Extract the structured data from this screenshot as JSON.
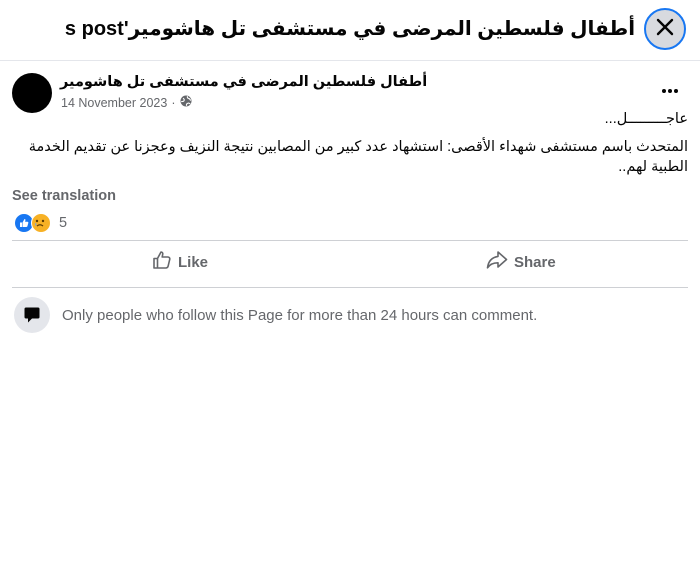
{
  "header": {
    "title": "أطفال فلسطين المرضى في مستشفى تل هاشومير's post",
    "close_icon": "close-icon"
  },
  "post": {
    "author": "أطفال فلسطين المرضى في مستشفى تل هاشومير",
    "date": "14 November 2023",
    "separator": "·",
    "audience_icon": "globe-icon",
    "more_icon": "more-icon",
    "text_line1": "عاجـــــــــل...",
    "text_line2": "المتحدث باسم مستشفى شهداء الأقصى: استشهاد عدد كبير من المصابين نتيجة النزيف وعجزنا عن تقديم الخدمة الطبية لهم..",
    "see_translation": "See translation",
    "reaction_icons": [
      "like-reaction-icon",
      "sad-reaction-icon"
    ],
    "reaction_count": "5"
  },
  "actions": {
    "like_label": "Like",
    "share_label": "Share"
  },
  "comments": {
    "notice": "Only people who follow this Page for more than 24 hours can comment."
  },
  "colors": {
    "accent": "#1877f2",
    "secondary_text": "#65676b",
    "divider": "#ced0d4"
  }
}
